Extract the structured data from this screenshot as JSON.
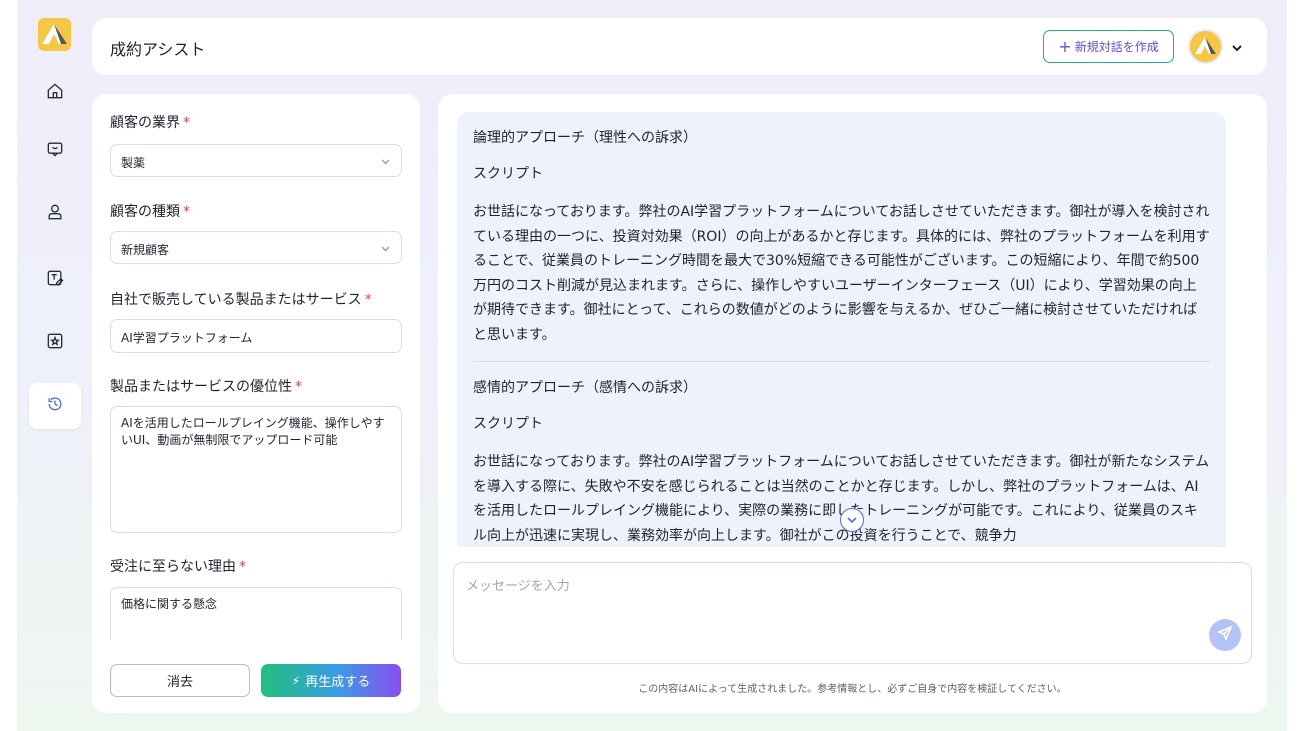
{
  "app": {
    "title": "成約アシスト"
  },
  "header": {
    "new_chat_label": "新規対話を作成"
  },
  "sidebar": {
    "items": [
      {
        "name": "home",
        "icon": "home-icon"
      },
      {
        "name": "chat",
        "icon": "chat-icon"
      },
      {
        "name": "customer",
        "icon": "user-icon"
      },
      {
        "name": "script",
        "icon": "edit-doc-icon"
      },
      {
        "name": "rating",
        "icon": "star-box-icon"
      },
      {
        "name": "history",
        "icon": "history-icon",
        "active": true
      }
    ]
  },
  "form": {
    "industry": {
      "label": "顧客の業界",
      "value": "製薬",
      "required": "*"
    },
    "customer_type": {
      "label": "顧客の種類",
      "value": "新規顧客",
      "required": "*"
    },
    "product": {
      "label": "自社で販売している製品またはサービス",
      "value": "AI学習プラットフォーム",
      "required": "*"
    },
    "advantage": {
      "label": "製品またはサービスの優位性",
      "value": "AIを活用したロールプレイング機能、操作しやすいUI、動画が無制限でアップロード可能",
      "required": "*"
    },
    "reason": {
      "label": "受注に至らない理由",
      "value": "価格に関する懸念",
      "required": "*"
    },
    "clear_label": "消去",
    "regenerate_label": "再生成する"
  },
  "response": {
    "sections": [
      {
        "heading": "論理的アプローチ（理性への訴求）",
        "sub": "スクリプト",
        "body": "お世話になっております。弊社のAI学習プラットフォームについてお話しさせていただきます。御社が導入を検討されている理由の一つに、投資対効果（ROI）の向上があるかと存じます。具体的には、弊社のプラットフォームを利用することで、従業員のトレーニング時間を最大で30%短縮できる可能性がございます。この短縮により、年間で約500万円のコスト削減が見込まれます。さらに、操作しやすいユーザーインターフェース（UI）により、学習効果の向上が期待できます。御社にとって、これらの数値がどのように影響を与えるか、ぜひご一緒に検討させていただければと思います。"
      },
      {
        "heading": "感情的アプローチ（感情への訴求）",
        "sub": "スクリプト",
        "body": "お世話になっております。弊社のAI学習プラットフォームについてお話しさせていただきます。御社が新たなシステムを導入する際に、失敗や不安を感じられることは当然のことかと存じます。しかし、弊社のプラットフォームは、AIを活用したロールプレイング機能により、実際の業務に即したトレーニングが可能です。これにより、従業員のスキル向上が迅速に実現し、業務効率が向上します。御社がこの投資を行うことで、競争力"
      }
    ]
  },
  "composer": {
    "placeholder": "メッセージを入力"
  },
  "footer": {
    "disclaimer": "この内容はAIによって生成されました。参考情報とし、必ずご自身で内容を検証してください。"
  },
  "colors": {
    "accent": "#4a6cf0",
    "brand_yellow": "#f6c744",
    "required": "#e54848",
    "green": "#22b07d"
  }
}
